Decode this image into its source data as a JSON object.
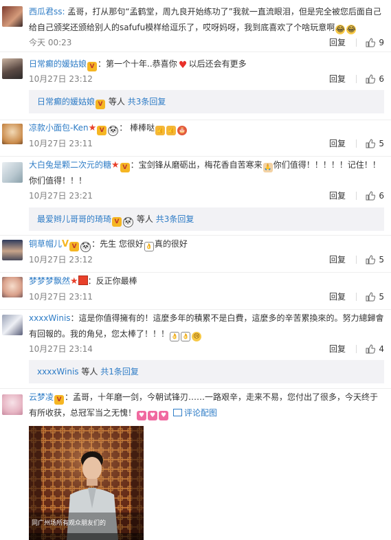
{
  "common": {
    "reply_label": "回复"
  },
  "comments": [
    {
      "user": "西瓜君ss",
      "text": "孟哥，打从那句“孟鹤堂，周九良开始练功了”我就一直流眼泪，但是完全被您后面自己给自己颁奖还颁给别人的safufu模样给逗乐了，哎呀妈呀，我到底喜欢了个啥玩意啊",
      "time": "今天 00:23",
      "likes": "9"
    },
    {
      "user": "日常癫的媛姑娘",
      "text_a": "：第一个十年..恭喜你",
      "text_b": "以后还会有更多",
      "time": "10月27日 23:12",
      "likes": "6",
      "sub_user": "日常癫的媛姑娘",
      "sub_etc": "等人",
      "sub_count": "共3条回复"
    },
    {
      "user": "凉款小面包-Ken",
      "text": "：  棒棒哒",
      "time": "10月27日 23:11",
      "likes": "5"
    },
    {
      "user": "大白兔是颗二次元的糖",
      "text": "：宝剑锋从磨砺出，梅花香自苦寒来",
      "text_b": "你们值得！！！！！记住！！你们值得！！！",
      "time": "10月27日 23:21",
      "likes": "6",
      "sub_user": "最爱辫儿哥哥的琦琦",
      "sub_etc": "等人",
      "sub_count": "共3条回复"
    },
    {
      "user": "铜草帽儿",
      "text_a": "：先生 您很好",
      "text_b": "真的很好",
      "time": "10月27日 23:12",
      "likes": "5"
    },
    {
      "user": "梦梦梦飘然",
      "text": "：反正你最棒",
      "time": "10月27日 23:11",
      "likes": "5"
    },
    {
      "user": "xxxxWinis",
      "text": "：這是你值得擁有的！這麼多年的積累不是白費，這麼多的辛苦累換來的。努力總歸會有回報的。我的角兒，您太棒了！！！",
      "time": "10月27日 23:14",
      "likes": "4",
      "sub_user": "xxxxWinis",
      "sub_etc": "等人",
      "sub_count": "共1条回复"
    },
    {
      "user": "云梦凌",
      "text": "：孟哥，十年磨一剑，今朝试锋刃……一路艰辛，走来不易，您付出了很多，今天终于有所收获，总冠军当之无愧！",
      "pic_label": "评论配图",
      "photo_caption": "同广州场所有观众朋友们的"
    }
  ],
  "colors": {
    "username": "#eb7350",
    "link": "#2e7cc6",
    "meta": "#808080",
    "subbar": "#f2f2f5"
  }
}
